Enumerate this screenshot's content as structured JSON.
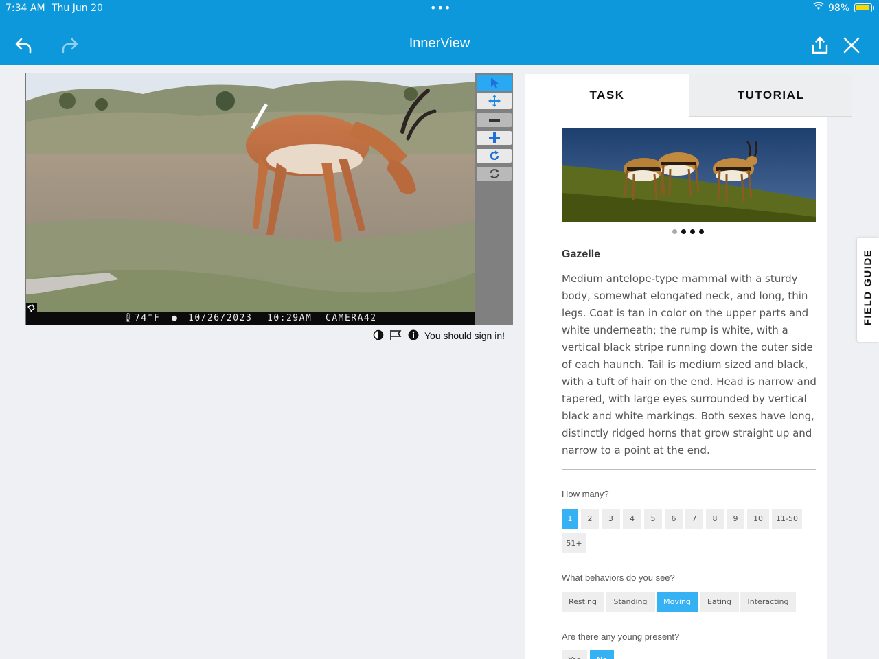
{
  "status": {
    "time": "7:34 AM",
    "date": "Thu Jun 20",
    "dots": "•••",
    "battery": "98%"
  },
  "app": {
    "title": "InnerView"
  },
  "camera": {
    "temp": "74°F",
    "date": "10/26/2023",
    "time": "10:29AM",
    "camera": "CAMERA42"
  },
  "meta": {
    "signin": "You should sign in!"
  },
  "tabs": {
    "task": "TASK",
    "tutorial": "TUTORIAL"
  },
  "field_guide": "FIELD GUIDE",
  "species": {
    "name": "Gazelle",
    "description": "Medium antelope-type mammal with a sturdy body, somewhat elongated neck, and long, thin legs. Coat is tan in color on the upper parts and white underneath; the rump is white, with a vertical black stripe running down the outer side of each haunch. Tail is medium sized and black, with a tuft of hair on the end. Head is narrow and tapered, with large eyes surrounded by vertical black and white markings. Both sexes have long, distinctly ridged horns that grow straight up and narrow to a point at the end."
  },
  "questions": {
    "how_many": {
      "label": "How many?",
      "options": [
        "1",
        "2",
        "3",
        "4",
        "5",
        "6",
        "7",
        "8",
        "9",
        "10",
        "11-50",
        "51+"
      ],
      "selected": "1"
    },
    "behaviors": {
      "label": "What behaviors do you see?",
      "options": [
        "Resting",
        "Standing",
        "Moving",
        "Eating",
        "Interacting"
      ],
      "selected": "Moving"
    },
    "young": {
      "label": "Are there any young present?",
      "options": [
        "Yes",
        "No"
      ],
      "selected": "No"
    }
  },
  "colors": {
    "accent": "#0d98db",
    "selected": "#36b2f4",
    "battery": "#ffd700"
  }
}
